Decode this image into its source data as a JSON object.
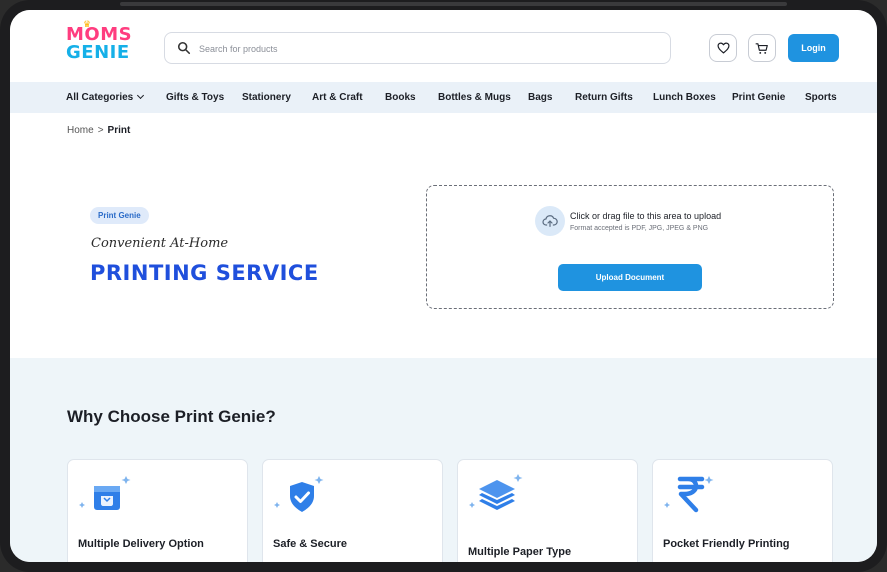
{
  "header": {
    "logo_line1": "MOMS",
    "logo_line2": "GENIE",
    "search_placeholder": "Search for products",
    "login_label": "Login"
  },
  "nav": {
    "items": [
      "All Categories",
      "Gifts & Toys",
      "Stationery",
      "Art & Craft",
      "Books",
      "Bottles & Mugs",
      "Bags",
      "Return Gifts",
      "Lunch Boxes",
      "Print Genie",
      "Sports"
    ]
  },
  "breadcrumb": {
    "home": "Home",
    "separator": ">",
    "current": "Print"
  },
  "hero": {
    "badge": "Print Genie",
    "tagline": "Convenient At-Home",
    "title": "PRINTING SERVICE"
  },
  "upload": {
    "title": "Click or drag file to this area to upload",
    "subtitle": "Format accepted is PDF, JPG, JPEG & PNG",
    "button_label": "Upload Document"
  },
  "why": {
    "title": "Why Choose Print Genie?",
    "cards": [
      {
        "title": "Multiple Delivery Option",
        "icon": "delivery-box-icon"
      },
      {
        "title": "Safe & Secure",
        "icon": "shield-check-icon"
      },
      {
        "title": "Multiple Paper Type",
        "icon": "layers-icon"
      },
      {
        "title": "Pocket Friendly Printing",
        "icon": "rupee-icon"
      }
    ]
  },
  "colors": {
    "primary_blue": "#1f93e0",
    "title_blue": "#1f4fdc",
    "brand_pink": "#ff3d7f",
    "brand_cyan": "#16b0e8",
    "nav_bg": "#eaf1f8",
    "section_bg": "#eef5f9"
  }
}
